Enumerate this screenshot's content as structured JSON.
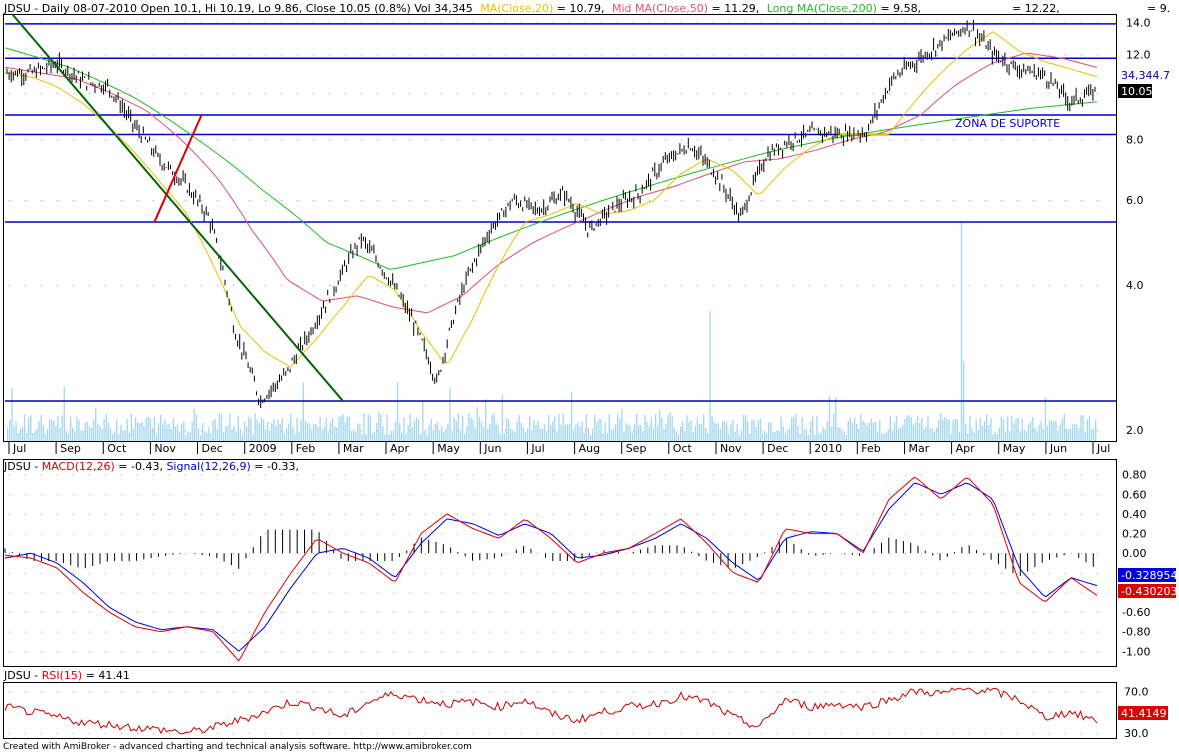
{
  "header": {
    "price": {
      "prefix": "JDSU - Daily 08-07-2010 Open 10.1, Hi 10.19, Lo 9.86, Close 10.05 (0.8%) Vol 34,345",
      "ma20_label": "MA(Close,20)",
      "ma20_value": " = 10.79,",
      "ma50_label": "Mid MA(Close,50)",
      "ma50_value": " = 11.29,",
      "ma200_label": "Long MA(Close,200)",
      "ma200_value": " = 9.58,",
      "extra_value": "= 12.22,",
      "right_clip": "= 9."
    },
    "macd": {
      "prefix": "JDSU - ",
      "macd_label": "MACD(12,26)",
      "macd_value": " = -0.43, ",
      "signal_label": "Signal(12,26,9)",
      "signal_value": " = -0.33,"
    },
    "rsi": {
      "prefix": "JDSU - ",
      "rsi_label": "RSI(15)",
      "rsi_value": " = 41.41"
    }
  },
  "annotation": {
    "zona": "ZONA DE SUPORTE"
  },
  "badges": {
    "volume": "34,344.7",
    "close": "10.05",
    "signal": "-0.328954",
    "macd": "-0.430203",
    "rsi": "41.4149"
  },
  "credit": "Created with AmiBroker - advanced charting and technical analysis software. http://www.amibroker.com",
  "colors": {
    "price": "#000000",
    "ma20": "#e6c200",
    "ma50": "#e05070",
    "ma200": "#22bb22",
    "hline": "#0000cc",
    "trend_green": "#006600",
    "trend_red": "#dd0000",
    "volume": "#a8d8f0",
    "macd": "#dd0000",
    "signal": "#0000dd",
    "rsi": "#cc0000"
  },
  "chart_data": [
    {
      "type": "line",
      "title": "JDSU - Daily 08-07-2010",
      "x": [
        "Jul",
        "Sep",
        "Oct",
        "Nov",
        "Dec",
        "2009",
        "Feb",
        "Mar",
        "Apr",
        "May",
        "Jun",
        "Jul",
        "Aug",
        "Sep",
        "Oct",
        "Nov",
        "Dec",
        "2010",
        "Feb",
        "Mar",
        "Apr",
        "May",
        "Jun",
        "Jul"
      ],
      "y_scale": "log",
      "y_ticks": [
        "14.0",
        "12.0",
        "10.0",
        "8.0",
        "6.0",
        "4.0",
        "2.0"
      ],
      "ylim": [
        1.9,
        14.5
      ],
      "series": [
        {
          "name": "Close",
          "values": [
            11.0,
            11.0,
            11.5,
            10.6,
            10.3,
            8.6,
            7.3,
            6.5,
            5.5,
            3.2,
            2.3,
            2.6,
            3.2,
            4.0,
            5.0,
            4.2,
            3.4,
            2.5,
            3.9,
            5.1,
            6.0,
            5.7,
            6.2,
            5.2,
            5.8,
            6.2,
            7.2,
            7.8,
            6.8,
            5.5,
            7.4,
            8.0,
            8.3,
            8.2,
            8.3,
            10.7,
            11.7,
            12.8,
            13.8,
            12.0,
            11.2,
            10.9,
            9.6,
            10.05
          ]
        },
        {
          "name": "MA(Close,20)",
          "values": [
            11.0,
            10.8,
            10.3,
            9.5,
            8.5,
            7.5,
            6.5,
            5.6,
            4.4,
            3.3,
            2.9,
            2.7,
            3.1,
            3.6,
            4.2,
            3.9,
            3.2,
            2.7,
            3.4,
            4.4,
            5.4,
            5.6,
            5.9,
            5.6,
            5.7,
            6.0,
            6.8,
            7.3,
            6.9,
            6.1,
            7.0,
            7.7,
            8.2,
            8.2,
            8.2,
            9.6,
            11.0,
            12.3,
            13.4,
            12.2,
            11.6,
            11.2,
            10.8
          ]
        },
        {
          "name": "Mid MA(Close,50)",
          "values": [
            11.3,
            11.0,
            10.7,
            10.0,
            9.2,
            8.0,
            6.7,
            5.2,
            4.1,
            3.7,
            3.8,
            3.6,
            3.5,
            3.8,
            4.4,
            4.9,
            5.3,
            5.7,
            6.1,
            6.4,
            6.8,
            7.2,
            7.3,
            7.6,
            8.0,
            8.3,
            9.0,
            10.4,
            11.5,
            12.1,
            11.8,
            11.29
          ]
        },
        {
          "name": "Long MA(Close,200)",
          "values": [
            12.4,
            11.3,
            9.8,
            8.0,
            6.3,
            4.9,
            4.3,
            4.6,
            5.2,
            5.8,
            6.4,
            7.0,
            7.6,
            8.1,
            8.5,
            8.9,
            9.3,
            9.58
          ]
        }
      ],
      "horizontal_lines": [
        13.9,
        11.8,
        9.0,
        8.2,
        5.4,
        2.3
      ],
      "trendlines": [
        {
          "color": "green",
          "from": [
            "Mar",
            2.3
          ],
          "to": [
            "Jul",
            14.5
          ]
        },
        {
          "color": "red",
          "from": [
            "Nov",
            5.4
          ],
          "to": [
            "Dec",
            9.0
          ]
        }
      ],
      "volume": {
        "max_value": 34344.7
      }
    },
    {
      "type": "line",
      "title": "MACD(12,26)",
      "y_ticks": [
        "0.80",
        "0.60",
        "0.40",
        "0.20",
        "0.00",
        "-0.20",
        "-0.40",
        "-0.60",
        "-0.80",
        "-1.00"
      ],
      "ylim": [
        -1.15,
        0.95
      ],
      "series": [
        {
          "name": "MACD(12,26)",
          "values": [
            -0.02,
            -0.05,
            -0.15,
            -0.4,
            -0.6,
            -0.75,
            -0.8,
            -0.75,
            -0.8,
            -1.1,
            -0.6,
            -0.2,
            0.15,
            0.0,
            -0.1,
            -0.3,
            0.2,
            0.4,
            0.25,
            0.15,
            0.35,
            0.15,
            -0.1,
            0.0,
            0.05,
            0.2,
            0.35,
            0.1,
            -0.2,
            -0.3,
            0.25,
            0.2,
            0.2,
            0.0,
            0.55,
            0.78,
            0.55,
            0.78,
            0.5,
            -0.3,
            -0.5,
            -0.25,
            -0.43
          ]
        },
        {
          "name": "Signal(12,26,9)",
          "values": [
            -0.05,
            0.0,
            -0.1,
            -0.3,
            -0.55,
            -0.7,
            -0.78,
            -0.75,
            -0.78,
            -1.0,
            -0.75,
            -0.35,
            0.0,
            0.05,
            -0.05,
            -0.25,
            0.1,
            0.35,
            0.3,
            0.18,
            0.3,
            0.2,
            -0.05,
            -0.02,
            0.05,
            0.15,
            0.3,
            0.15,
            -0.1,
            -0.28,
            0.15,
            0.22,
            0.2,
            0.02,
            0.45,
            0.72,
            0.6,
            0.72,
            0.55,
            -0.15,
            -0.45,
            -0.25,
            -0.33
          ]
        }
      ]
    },
    {
      "type": "line",
      "title": "RSI(15)",
      "y_ticks": [
        "70.0",
        "30.0"
      ],
      "ylim": [
        25,
        78
      ],
      "series": [
        {
          "name": "RSI(15)",
          "values": [
            55,
            50,
            45,
            40,
            38,
            35,
            33,
            30,
            35,
            42,
            50,
            60,
            55,
            45,
            60,
            68,
            62,
            58,
            60,
            55,
            62,
            48,
            42,
            50,
            55,
            58,
            65,
            60,
            45,
            35,
            62,
            55,
            58,
            55,
            62,
            70,
            68,
            72,
            70,
            62,
            45,
            50,
            41.41
          ]
        }
      ]
    }
  ]
}
